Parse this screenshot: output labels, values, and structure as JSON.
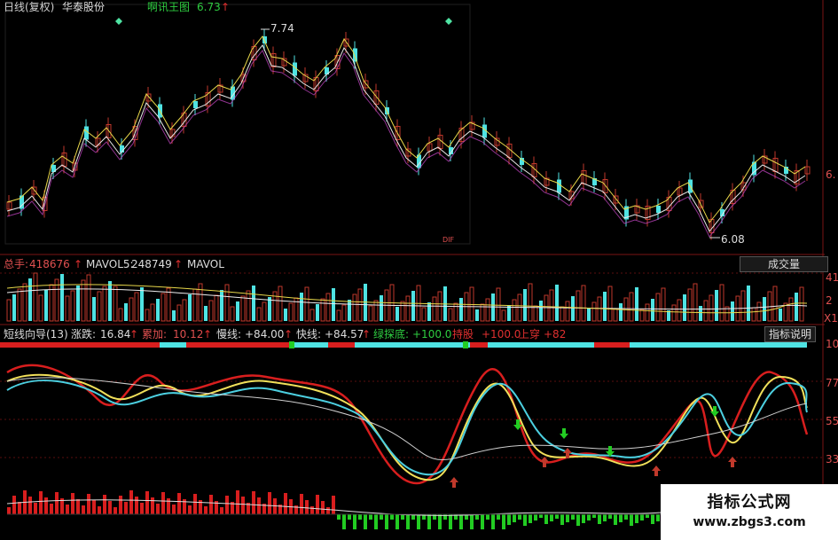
{
  "header": {
    "title": "日线(复权)",
    "stock": "华泰股份",
    "indicator": "啊讯王图",
    "indicator_value": "6.73",
    "up_arrow": "↑"
  },
  "price_panel": {
    "high_label": "7.74",
    "low_label": "6.08",
    "right_tick": "6.",
    "mid_marker": "DIF"
  },
  "volume_panel": {
    "total_label": "总手:",
    "total_value": "418676",
    "mavol5_label": "MAVOL5:",
    "mavol5_value": "248749",
    "mavol_label": "MAVOL",
    "button_label": "成交量",
    "right_ticks": [
      "41",
      "2",
      "X1"
    ]
  },
  "indicator_panel": {
    "name": "短线向导(13)",
    "zd_label": "涨跌:",
    "zd_value": "16.84",
    "lj_label": "累加:",
    "lj_value": "10.12",
    "slow_label": "慢线:",
    "slow_value": "+84.00",
    "fast_label": "快线:",
    "fast_value": "+84.57",
    "green_label": "绿探底:",
    "green_value": "+100.0",
    "hold_label": "持股",
    "hold_value": "+100.0",
    "cross_label": "上穿",
    "cross_value": "+82",
    "button_label": "指标说明",
    "right_ticks": [
      "10",
      "77",
      "55",
      "33"
    ]
  },
  "watermark": {
    "line1": "指标公式网",
    "line2": "www.zbgs3.com"
  },
  "colors": {
    "up": "#c0392b",
    "down": "#4fe3e3",
    "yellow": "#f1e05a",
    "red_line": "#d81e1e",
    "cyan_line": "#4ccfe0",
    "white_line": "#cfcfcf",
    "green": "#22cc22"
  }
}
